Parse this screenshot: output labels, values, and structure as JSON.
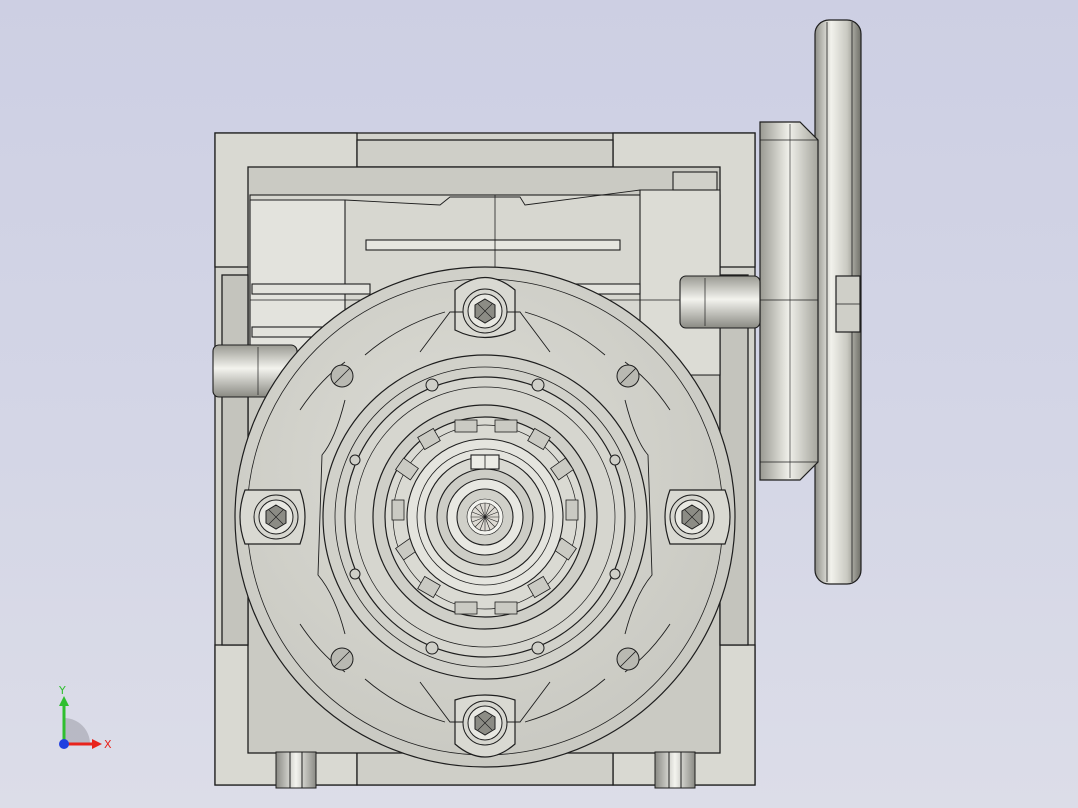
{
  "viewport": {
    "background_top": "#cdcfe3",
    "background_bottom": "#dcdde8",
    "part_fill": "#d6d6cf",
    "part_shadow": "#8d8d86",
    "edge_color": "#1e1e1e"
  },
  "model": {
    "shaded_with_edges": true
  },
  "triad": {
    "x_label": "X",
    "y_label": "Y",
    "x_color": "#e8231c",
    "y_color": "#2fbf2f",
    "z_color": "#1f3fe0"
  }
}
